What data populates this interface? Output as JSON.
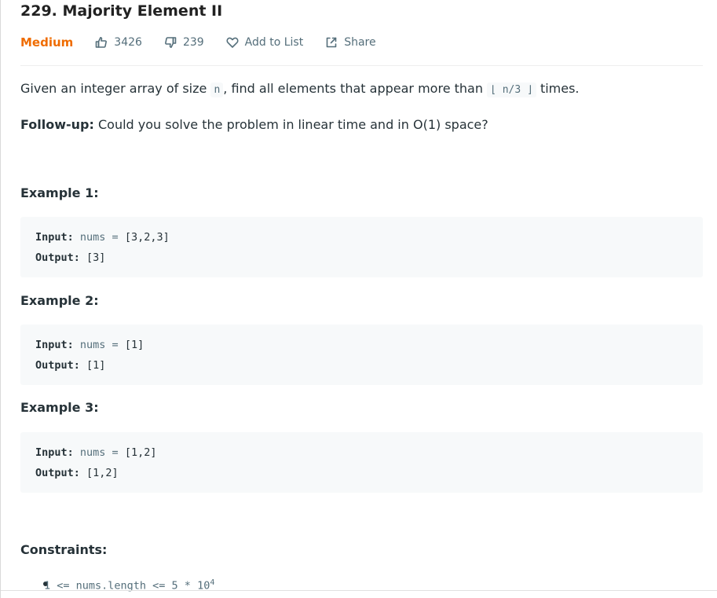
{
  "problem": {
    "title": "229. Majority Element II",
    "difficulty": "Medium",
    "likes": "3426",
    "dislikes": "239",
    "add_to_list": "Add to List",
    "share": "Share"
  },
  "description": {
    "p1_prefix": "Given an integer array of size ",
    "p1_code1": "n",
    "p1_middle": ", find all elements that appear more than ",
    "p1_code2": "⌊ n/3 ⌋",
    "p1_suffix": " times.",
    "followup_label": "Follow-up:",
    "followup_text": " Could you solve the problem in linear time and in O(1) space?"
  },
  "examples": [
    {
      "heading": "Example 1:",
      "input_label": "Input:",
      "input_var": " nums = ",
      "input_value": "[3,2,3]",
      "output_label": "Output:",
      "output_value": " [3]"
    },
    {
      "heading": "Example 2:",
      "input_label": "Input:",
      "input_var": " nums = ",
      "input_value": "[1]",
      "output_label": "Output:",
      "output_value": " [1]"
    },
    {
      "heading": "Example 3:",
      "input_label": "Input:",
      "input_var": " nums = ",
      "input_value": "[1,2]",
      "output_label": "Output:",
      "output_value": " [1,2]"
    }
  ],
  "constraints": {
    "heading": "Constraints:",
    "items": [
      {
        "text": "1 <= nums.length <= 5 * 10",
        "sup": "4"
      }
    ]
  },
  "colors": {
    "difficulty_medium": "#ef6c00",
    "code_bg": "#f7f9fa",
    "text": "#263238",
    "muted": "#546e7a"
  },
  "icons": {
    "likes": "thumbs-up-icon",
    "dislikes": "thumbs-down-icon",
    "add_to_list": "heart-icon",
    "share": "share-icon"
  }
}
